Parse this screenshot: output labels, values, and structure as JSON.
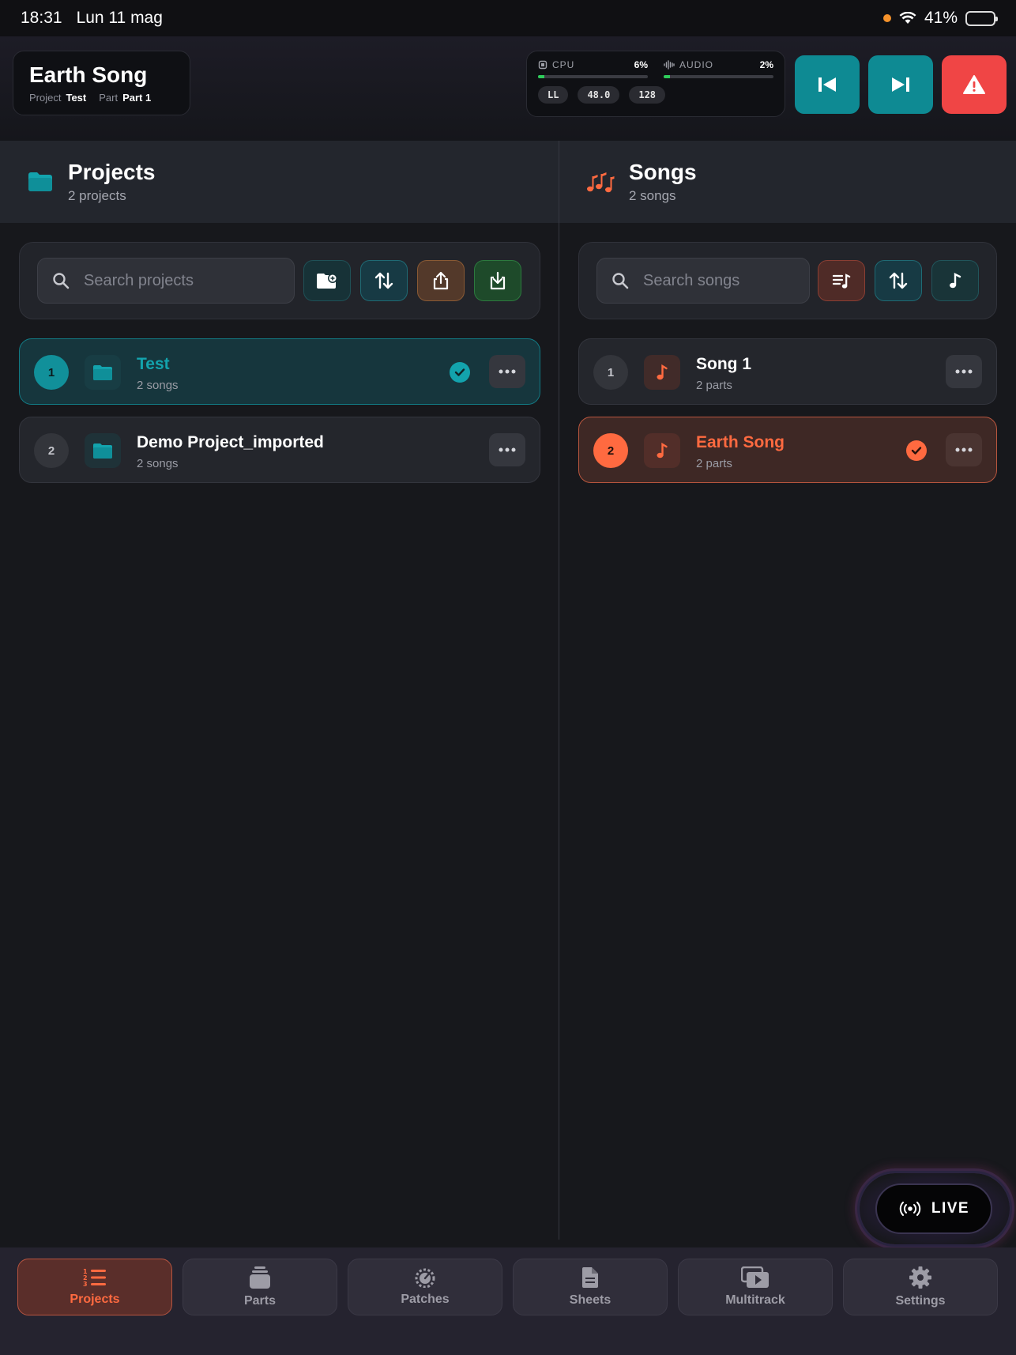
{
  "status_bar": {
    "time": "18:31",
    "date": "Lun 11 mag",
    "battery": "41%"
  },
  "header": {
    "song_title": "Earth Song",
    "project_label": "Project",
    "project_value": "Test",
    "part_label": "Part",
    "part_value": "Part 1",
    "cpu": {
      "label": "CPU",
      "value": "6%",
      "fill": 0.06
    },
    "audio": {
      "label": "AUDIO",
      "value": "2%",
      "fill": 0.02
    },
    "chips": [
      "LL",
      "48.0",
      "128"
    ]
  },
  "projects": {
    "title": "Projects",
    "subtitle": "2 projects",
    "search_placeholder": "Search projects",
    "items": [
      {
        "num": "1",
        "name": "Test",
        "sub": "2 songs",
        "selected": true
      },
      {
        "num": "2",
        "name": "Demo Project_imported",
        "sub": "2 songs",
        "selected": false
      }
    ]
  },
  "songs": {
    "title": "Songs",
    "subtitle": "2 songs",
    "search_placeholder": "Search songs",
    "items": [
      {
        "num": "1",
        "name": "Song 1",
        "sub": "2 parts",
        "selected": false
      },
      {
        "num": "2",
        "name": "Earth Song",
        "sub": "2 parts",
        "selected": true
      }
    ]
  },
  "live_label": "LIVE",
  "nav": [
    {
      "label": "Projects",
      "icon": "numbered-list-icon",
      "active": true
    },
    {
      "label": "Parts",
      "icon": "stack-icon",
      "active": false
    },
    {
      "label": "Patches",
      "icon": "gauge-icon",
      "active": false
    },
    {
      "label": "Sheets",
      "icon": "document-icon",
      "active": false
    },
    {
      "label": "Multitrack",
      "icon": "play-stack-icon",
      "active": false
    },
    {
      "label": "Settings",
      "icon": "gear-icon",
      "active": false
    }
  ],
  "colors": {
    "teal": "#0e8a93",
    "orange": "#ff6a40",
    "red": "#f04545",
    "green": "#2ecc5a"
  }
}
